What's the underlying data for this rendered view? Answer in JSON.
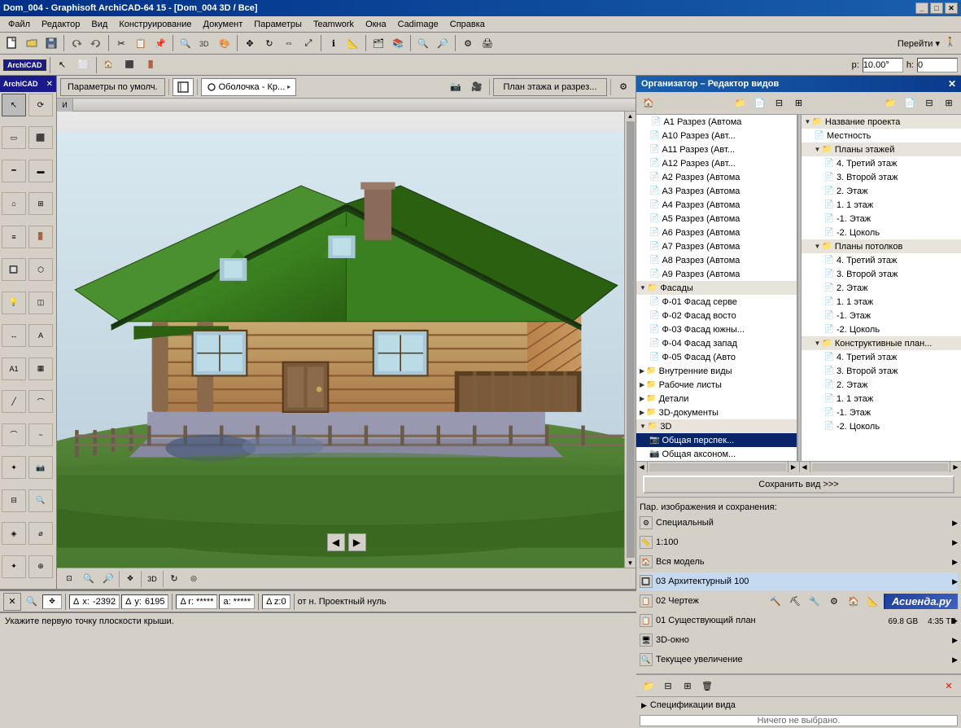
{
  "titlebar": {
    "title": "Dom_004 - Graphisoft ArchiCAD-64 15 - [Dom_004 3D / Все]",
    "minimize": "_",
    "maximize": "□",
    "close": "✕"
  },
  "menubar": {
    "items": [
      "Файл",
      "Редактор",
      "Вид",
      "Конструирование",
      "Документ",
      "Параметры",
      "Teamwork",
      "Окна",
      "Cadimage",
      "Справка"
    ]
  },
  "archicad_logo": "ArchiCAD",
  "canvas_top": {
    "params_button": "Параметры по умолч.",
    "shell_label": "Оболочка - Кр...",
    "plan_button": "План этажа и разрез..."
  },
  "organizer": {
    "title": "Организатор – Редактор видов",
    "left_tree": [
      {
        "label": "А1 Разрез (Автома",
        "indent": 1,
        "icon": "📄",
        "expand": false
      },
      {
        "label": "А10 Разрез (Авто...",
        "indent": 1,
        "icon": "📄",
        "expand": false
      },
      {
        "label": "А11 Разрез (Авто...",
        "indent": 1,
        "icon": "📄",
        "expand": false
      },
      {
        "label": "А12 Разрез (Авто...",
        "indent": 1,
        "icon": "📄",
        "expand": false
      },
      {
        "label": "А2 Разрез (Автома",
        "indent": 1,
        "icon": "📄",
        "expand": false
      },
      {
        "label": "А3 Разрез (Автома",
        "indent": 1,
        "icon": "📄",
        "expand": false
      },
      {
        "label": "А4 Разрез (Автома",
        "indent": 1,
        "icon": "📄",
        "expand": false
      },
      {
        "label": "А5 Разрез (Автома",
        "indent": 1,
        "icon": "📄",
        "expand": false
      },
      {
        "label": "А6 Разрез (Автома",
        "indent": 1,
        "icon": "📄",
        "expand": false
      },
      {
        "label": "А7 Разрез (Автома",
        "indent": 1,
        "icon": "📄",
        "expand": false
      },
      {
        "label": "А8 Разрез (Автома",
        "indent": 1,
        "icon": "📄",
        "expand": false
      },
      {
        "label": "А9 Разрез (Автома",
        "indent": 1,
        "icon": "📄",
        "expand": false
      },
      {
        "label": "Фасады",
        "indent": 0,
        "icon": "📁",
        "expand": true
      },
      {
        "label": "Ф-01 Фасад серве",
        "indent": 1,
        "icon": "📄",
        "expand": false
      },
      {
        "label": "Ф-02 Фасад восто",
        "indent": 1,
        "icon": "📄",
        "expand": false
      },
      {
        "label": "Ф-03 Фасад южны...",
        "indent": 1,
        "icon": "📄",
        "expand": false
      },
      {
        "label": "Ф-04 Фасад запад",
        "indent": 1,
        "icon": "📄",
        "expand": false
      },
      {
        "label": "Ф-05 Фасад (Авто",
        "indent": 1,
        "icon": "📄",
        "expand": false
      },
      {
        "label": "Внутренние виды",
        "indent": 0,
        "icon": "📁",
        "expand": false
      },
      {
        "label": "Рабочие листы",
        "indent": 0,
        "icon": "📁",
        "expand": false
      },
      {
        "label": "Детали",
        "indent": 0,
        "icon": "📁",
        "expand": false
      },
      {
        "label": "3D-документы",
        "indent": 0,
        "icon": "📁",
        "expand": false
      },
      {
        "label": "3D",
        "indent": 0,
        "icon": "📁",
        "expand": true
      },
      {
        "label": "Общая перспек...",
        "indent": 1,
        "icon": "📄",
        "expand": false,
        "selected": true
      },
      {
        "label": "Общая аксоном...",
        "indent": 1,
        "icon": "📄",
        "expand": false
      }
    ],
    "right_tree": [
      {
        "label": "Название проекта",
        "indent": 0,
        "icon": "📁",
        "expand": true
      },
      {
        "label": "Местность",
        "indent": 1,
        "icon": "📄",
        "expand": false
      },
      {
        "label": "Планы этажей",
        "indent": 1,
        "icon": "📁",
        "expand": true
      },
      {
        "label": "4. Третий этаж",
        "indent": 2,
        "icon": "📄",
        "expand": false
      },
      {
        "label": "3. Второй этаж",
        "indent": 2,
        "icon": "📄",
        "expand": false
      },
      {
        "label": "2. Этаж",
        "indent": 2,
        "icon": "📄",
        "expand": false
      },
      {
        "label": "1. 1 этаж",
        "indent": 2,
        "icon": "📄",
        "expand": false
      },
      {
        "label": "-1. Этаж",
        "indent": 2,
        "icon": "📄",
        "expand": false
      },
      {
        "label": "-2. Цоколь",
        "indent": 2,
        "icon": "📄",
        "expand": false
      },
      {
        "label": "Планы потолков",
        "indent": 1,
        "icon": "📁",
        "expand": true
      },
      {
        "label": "4. Третий этаж",
        "indent": 2,
        "icon": "📄",
        "expand": false
      },
      {
        "label": "3. Второй этаж",
        "indent": 2,
        "icon": "📄",
        "expand": false
      },
      {
        "label": "2. Этаж",
        "indent": 2,
        "icon": "📄",
        "expand": false
      },
      {
        "label": "1. 1 этаж",
        "indent": 2,
        "icon": "📄",
        "expand": false
      },
      {
        "label": "-1. Этаж",
        "indent": 2,
        "icon": "📄",
        "expand": false
      },
      {
        "label": "-2. Цоколь",
        "indent": 2,
        "icon": "📄",
        "expand": false
      },
      {
        "label": "Конструктивные план...",
        "indent": 1,
        "icon": "📁",
        "expand": true
      },
      {
        "label": "4. Третий этаж",
        "indent": 2,
        "icon": "📄",
        "expand": false
      },
      {
        "label": "3. Второй этаж",
        "indent": 2,
        "icon": "📄",
        "expand": false
      },
      {
        "label": "2. Этаж",
        "indent": 2,
        "icon": "📄",
        "expand": false
      },
      {
        "label": "1. 1 этаж",
        "indent": 2,
        "icon": "📄",
        "expand": false
      },
      {
        "label": "-1. Этаж",
        "indent": 2,
        "icon": "📄",
        "expand": false
      },
      {
        "label": "-2. Цоколь",
        "indent": 2,
        "icon": "📄",
        "expand": false
      }
    ],
    "save_button": "Сохранить вид >>>"
  },
  "params_section": {
    "label": "Пар. изображения и сохранения:",
    "rows": [
      {
        "icon": "⚙",
        "label": "Специальный"
      },
      {
        "icon": "📏",
        "label": "1:100"
      },
      {
        "icon": "🏠",
        "label": "Вся модель"
      },
      {
        "icon": "🔲",
        "label": "03 Архитектурный 100"
      },
      {
        "icon": "📋",
        "label": "02 Чертеж"
      },
      {
        "icon": "📋",
        "label": "01 Существующий план"
      },
      {
        "icon": "🖥",
        "label": "3D-окно"
      },
      {
        "icon": "🔍",
        "label": "Текущее увеличение"
      }
    ]
  },
  "specs": {
    "title": "Спецификации вида",
    "empty_label": "Ничего не выбрано."
  },
  "statusbar": {
    "hint": "Укажите первую точку плоскости крыши.",
    "dz_label": "Δ x:",
    "dx_val": "-2392",
    "dy_label": "Δ y:",
    "dy_val": "6195",
    "dr_label": "Δ r: *****",
    "da_label": "a: *****",
    "dz_val": "0",
    "origin": "от н. Проектный нуль",
    "filesize": "69.8 GB",
    "time": "4:35 TB"
  },
  "coords": {
    "p_label": "р:",
    "p_val": "10.00°",
    "h_label": "h:",
    "h_val": "0"
  }
}
